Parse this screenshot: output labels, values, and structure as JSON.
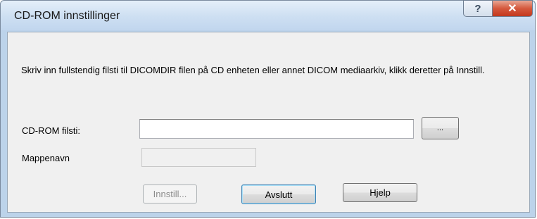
{
  "window": {
    "title": "CD-ROM innstillinger",
    "help_glyph": "?",
    "close_glyph": "✕"
  },
  "dialog": {
    "description": "Skriv inn fullstendig filsti til DICOMDIR filen på CD enheten eller annet DICOM mediaarkiv, klikk deretter på Innstill.",
    "cdrom_path_label": "CD-ROM filsti:",
    "cdrom_path_value": "",
    "browse_label": "...",
    "folder_name_label": "Mappenavn",
    "folder_name_value": ""
  },
  "buttons": {
    "set": "Innstill...",
    "exit": "Avslutt",
    "help": "Hjelp"
  },
  "colors": {
    "close_button": "#c8472a",
    "client_background": "#f0f0f0",
    "frame": "#bcd3ea"
  }
}
